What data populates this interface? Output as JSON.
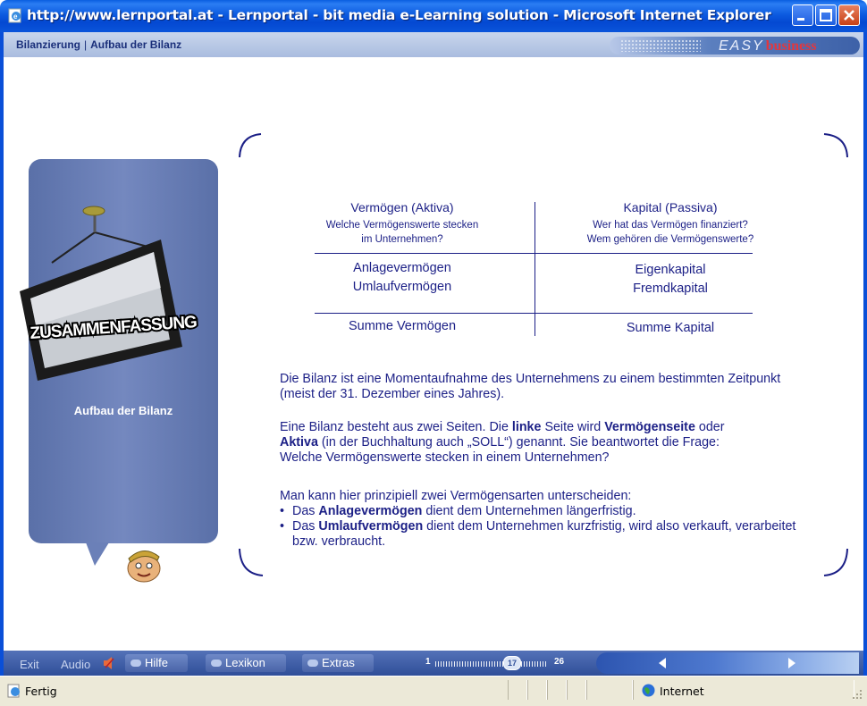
{
  "window": {
    "title": "http://www.lernportal.at - Lernportal - bit media e-Learning solution - Microsoft Internet Explorer"
  },
  "header": {
    "breadcrumb": [
      "Bilanzierung",
      "Aufbau der Bilanz"
    ],
    "breadcrumb_separator": "|",
    "brand_easy": "EASY",
    "brand_business": "business",
    "colors": {
      "bar": "#b6c6e6",
      "breadcrumb_text": "#1a2f7a",
      "brand_red": "#e2373e"
    }
  },
  "left_panel": {
    "sign_text": "ZUSAMMENFASSUNG",
    "title": "Aufbau der Bilanz",
    "colors": {
      "panel": "#6b80b8"
    }
  },
  "balance": {
    "left_header": "Vermögen (Aktiva)",
    "left_sub": [
      "Welche Vermögenswerte stecken",
      "im Unternehmen?"
    ],
    "right_header": "Kapital (Passiva)",
    "right_sub": [
      "Wer hat das Vermögen finanziert?",
      "Wem gehören die Vermögenswerte?"
    ],
    "left_items": [
      "Anlagevermögen",
      "Umlaufvermögen"
    ],
    "right_items": [
      "Eigenkapital",
      "Fremdkapital"
    ],
    "left_total": "Summe Vermögen",
    "right_total": "Summe Kapital"
  },
  "text": {
    "p1": "Die Bilanz ist eine Momentaufnahme des Unternehmens zu einem bestimmten Zeitpunkt (meist der 31. Dezember eines Jahres).",
    "p2": {
      "a": "Eine Bilanz besteht aus zwei Seiten. Die ",
      "b": "linke",
      "c": " Seite wird ",
      "d": "Vermögenseite",
      "e": " oder",
      "f": "Aktiva",
      "g": " (in der Buchhaltung auch „SOLL“) genannt. Sie beantwortet die Frage:",
      "h": "Welche Vermögenswerte stecken in einem Unternehmen?"
    },
    "p3": "Man kann hier prinzipiell zwei Vermögensarten unterscheiden:",
    "bullets": [
      {
        "pre": "Das ",
        "bold": "Anlagevermögen",
        "post": " dient dem Unternehmen längerfristig."
      },
      {
        "pre": "Das ",
        "bold": "Umlaufvermögen",
        "post": " dient dem Unternehmen kurzfristig, wird also verkauft, verarbeitet bzw. verbraucht."
      }
    ],
    "bullet_glyph": "•",
    "color": "#1b1f86"
  },
  "navbar": {
    "exit": "Exit",
    "audio": "Audio",
    "buttons": [
      "Hilfe",
      "Lexikon",
      "Extras"
    ],
    "progress": {
      "first": "1",
      "current": "17",
      "last": "26"
    },
    "colors": {
      "bar": "#3f5ea8"
    }
  },
  "statusbar": {
    "status": "Fertig",
    "zone": "Internet"
  },
  "icons": [
    "ie-page-icon",
    "minimize-icon",
    "maximize-icon",
    "close-icon",
    "speaker-icon",
    "prev-arrow-icon",
    "next-arrow-icon",
    "globe-icon",
    "resize-grip-icon"
  ]
}
